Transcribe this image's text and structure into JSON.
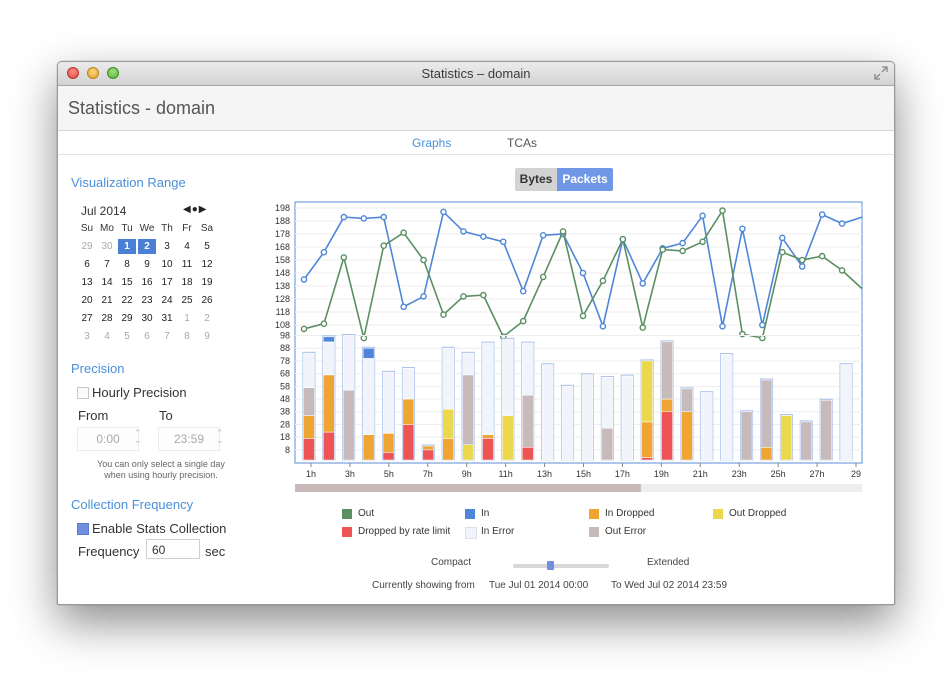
{
  "window": {
    "title": "Statistics – domain"
  },
  "app": {
    "title": "Statistics - domain"
  },
  "tabs": [
    {
      "label": "Graphs",
      "active": true
    },
    {
      "label": "TCAs",
      "active": false
    }
  ],
  "sidebar": {
    "visualization_range": {
      "title": "Visualization Range",
      "calendar": {
        "month_label": "Jul 2014",
        "nav": "◀●▶",
        "weekdays": [
          "Su",
          "Mo",
          "Tu",
          "We",
          "Th",
          "Fr",
          "Sa"
        ],
        "weeks": [
          [
            "29",
            "30",
            "1",
            "2",
            "3",
            "4",
            "5"
          ],
          [
            "6",
            "7",
            "8",
            "9",
            "10",
            "11",
            "12"
          ],
          [
            "13",
            "14",
            "15",
            "16",
            "17",
            "18",
            "19"
          ],
          [
            "20",
            "21",
            "22",
            "23",
            "24",
            "25",
            "26"
          ],
          [
            "27",
            "28",
            "29",
            "30",
            "31",
            "1",
            "2"
          ],
          [
            "3",
            "4",
            "5",
            "6",
            "7",
            "8",
            "9"
          ]
        ],
        "selected": [
          "1",
          "2"
        ]
      }
    },
    "precision": {
      "title": "Precision",
      "hourly_label": "Hourly Precision",
      "hourly_checked": false,
      "from_label": "From",
      "to_label": "To",
      "from_value": "0:00",
      "to_value": "23:59",
      "note_line1": "You can only select a single day",
      "note_line2": "when using hourly precision."
    },
    "collection": {
      "title": "Collection Frequency",
      "enable_label": "Enable Stats Collection",
      "enable_checked": true,
      "frequency_label": "Frequency",
      "frequency_value": "60",
      "unit": "sec"
    }
  },
  "graph_toggle": {
    "bytes": "Bytes",
    "packets": "Packets",
    "active": "Packets"
  },
  "colors": {
    "out": "#5a8f62",
    "in": "#4f86d9",
    "in_dropped": "#f0a532",
    "out_dropped": "#ecd84c",
    "dropped_by_rate_limit": "#ee5454",
    "in_error": "#f1f4fb",
    "out_error": "#c6babb"
  },
  "chart_data": {
    "type": "line+stacked-bar",
    "x_tick_labels": [
      "1h",
      "3h",
      "5h",
      "7h",
      "9h",
      "11h",
      "13h",
      "15h",
      "17h",
      "19h",
      "21h",
      "23h",
      "25h",
      "27h",
      "29"
    ],
    "line_panel": {
      "y_ticks": [
        108,
        118,
        128,
        138,
        148,
        158,
        168,
        178,
        188,
        198
      ],
      "series": [
        {
          "name": "In",
          "values": [
            143,
            164,
            191,
            190,
            191,
            122,
            130,
            195,
            180,
            176,
            172,
            134,
            177,
            178,
            148,
            107,
            174,
            140,
            167,
            171,
            192,
            107,
            182,
            108,
            175,
            153,
            193,
            186,
            191
          ]
        },
        {
          "name": "Out",
          "values": [
            105,
            109,
            160,
            98,
            169,
            179,
            158,
            116,
            130,
            131,
            99,
            111,
            145,
            180,
            115,
            142,
            174,
            106,
            166,
            165,
            172,
            196,
            101,
            98,
            164,
            158,
            161,
            150,
            136
          ]
        }
      ]
    },
    "bar_panel": {
      "y_ticks": [
        8,
        18,
        28,
        38,
        48,
        58,
        68,
        78,
        88,
        98
      ],
      "series_order": [
        "Dropped by rate limit",
        "In Dropped",
        "Out Dropped",
        "Out Error",
        "In Error",
        "In"
      ],
      "bars": [
        [
          17,
          18,
          0,
          22,
          27,
          0
        ],
        [
          22,
          45,
          0,
          0,
          26,
          4
        ],
        [
          0,
          0,
          0,
          55,
          43,
          0
        ],
        [
          0,
          20,
          0,
          0,
          60,
          8
        ],
        [
          6,
          15,
          0,
          0,
          48,
          0
        ],
        [
          28,
          20,
          0,
          0,
          24,
          0
        ],
        [
          8,
          3,
          0,
          0,
          0,
          0
        ],
        [
          0,
          17,
          23,
          0,
          48,
          0
        ],
        [
          0,
          0,
          12,
          55,
          17,
          0
        ],
        [
          17,
          3,
          0,
          0,
          72,
          0
        ],
        [
          0,
          0,
          35,
          0,
          60,
          0
        ],
        [
          10,
          0,
          0,
          41,
          41,
          0
        ],
        [
          0,
          0,
          0,
          0,
          75,
          0
        ],
        [
          0,
          0,
          0,
          0,
          58,
          0
        ],
        [
          0,
          0,
          0,
          0,
          67,
          0
        ],
        [
          0,
          0,
          0,
          25,
          40,
          0
        ],
        [
          0,
          0,
          0,
          0,
          66,
          0
        ],
        [
          2,
          28,
          48,
          0,
          0,
          0
        ],
        [
          38,
          10,
          0,
          45,
          0,
          0
        ]
      ],
      "bars_second_half": [
        [
          0,
          38,
          0,
          18,
          0,
          0
        ],
        [
          0,
          0,
          0,
          0,
          53,
          0
        ],
        [
          0,
          0,
          0,
          0,
          83,
          0
        ],
        [
          0,
          0,
          0,
          38,
          0,
          0
        ],
        [
          0,
          10,
          0,
          53,
          0,
          0
        ],
        [
          0,
          0,
          35,
          0,
          0,
          0
        ],
        [
          0,
          0,
          0,
          30,
          0,
          0
        ],
        [
          0,
          0,
          0,
          47,
          0,
          0
        ],
        [
          0,
          0,
          0,
          0,
          75,
          0
        ]
      ]
    },
    "legend": [
      {
        "name": "Out",
        "color": "#5a8f62"
      },
      {
        "name": "In",
        "color": "#4f86d9"
      },
      {
        "name": "In Dropped",
        "color": "#f0a532"
      },
      {
        "name": "Out Dropped",
        "color": "#ecd84c"
      },
      {
        "name": "Dropped by rate limit",
        "color": "#ee5454"
      },
      {
        "name": "In Error",
        "color": "#f1f4fb"
      },
      {
        "name": "Out Error",
        "color": "#c6babb"
      }
    ],
    "navigator_fraction": 0.61
  },
  "range_slider": {
    "compact_label": "Compact",
    "extended_label": "Extended",
    "value_fraction": 0.38
  },
  "showing": {
    "prefix": "Currently showing from",
    "from": "Tue Jul 01 2014 00:00",
    "to": "To Wed Jul 02 2014 23:59"
  }
}
